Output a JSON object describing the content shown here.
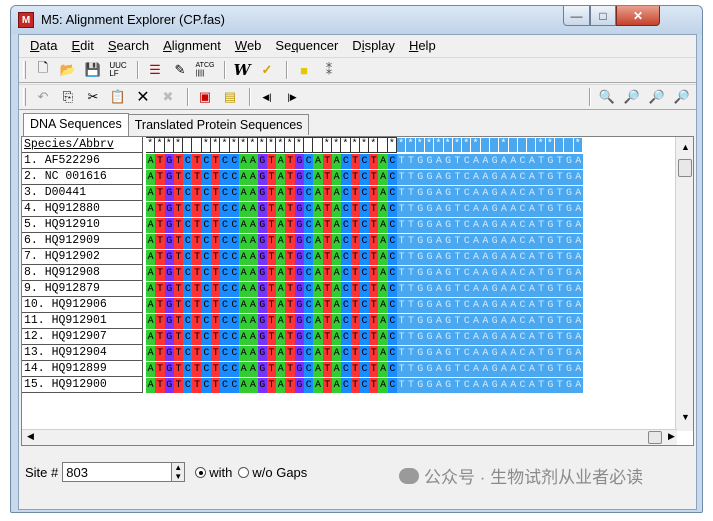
{
  "window": {
    "title": "M5: Alignment Explorer (CP.fas)",
    "app_icon_text": "M"
  },
  "menu": [
    "Data",
    "Edit",
    "Search",
    "Alignment",
    "Web",
    "Sequencer",
    "Display",
    "Help"
  ],
  "toolbar1": [
    "new-icon",
    "open-icon",
    "save-icon",
    "dna-vs-protein-icon",
    "list-icon",
    "edit-seq-icon",
    "atcg-icon",
    "w-icon",
    "v-icon",
    "square-icon",
    "marker-icon"
  ],
  "toolbar2": [
    "undo-icon",
    "copy-icon",
    "cut-icon",
    "paste-icon",
    "delete-icon",
    "delete-gap-icon",
    "insert-seq-icon",
    "add-seq-icon",
    "prev-icon",
    "next-icon",
    "find-icon",
    "find-prev-icon",
    "find-next-icon",
    "find-mark-icon"
  ],
  "tabs": [
    "DNA Sequences",
    "Translated Protein Sequences"
  ],
  "header": "Species/Abbrv",
  "consensus": "****  ***********  ****** **********  *   **  ******* ",
  "species": [
    "1. AF522296",
    "2. NC 001616",
    "3. D00441",
    "4. HQ912880",
    "5. HQ912910",
    "6. HQ912909",
    "7. HQ912902",
    "8. HQ912908",
    "9. HQ912879",
    "10. HQ912906",
    "11. HQ912901",
    "12. HQ912907",
    "13. HQ912904",
    "14. HQ912899",
    "15. HQ912900"
  ],
  "sequence": "ATGTCTCTCCAAGTATGCATACTCTACTTGGAGTCAAGAACATGTGA",
  "status": {
    "site_label": "Site #",
    "site_value": "803",
    "with_gaps": "with",
    "without_gaps": "w/o Gaps"
  },
  "watermark": "公众号 · 生物试剂从业者必读"
}
